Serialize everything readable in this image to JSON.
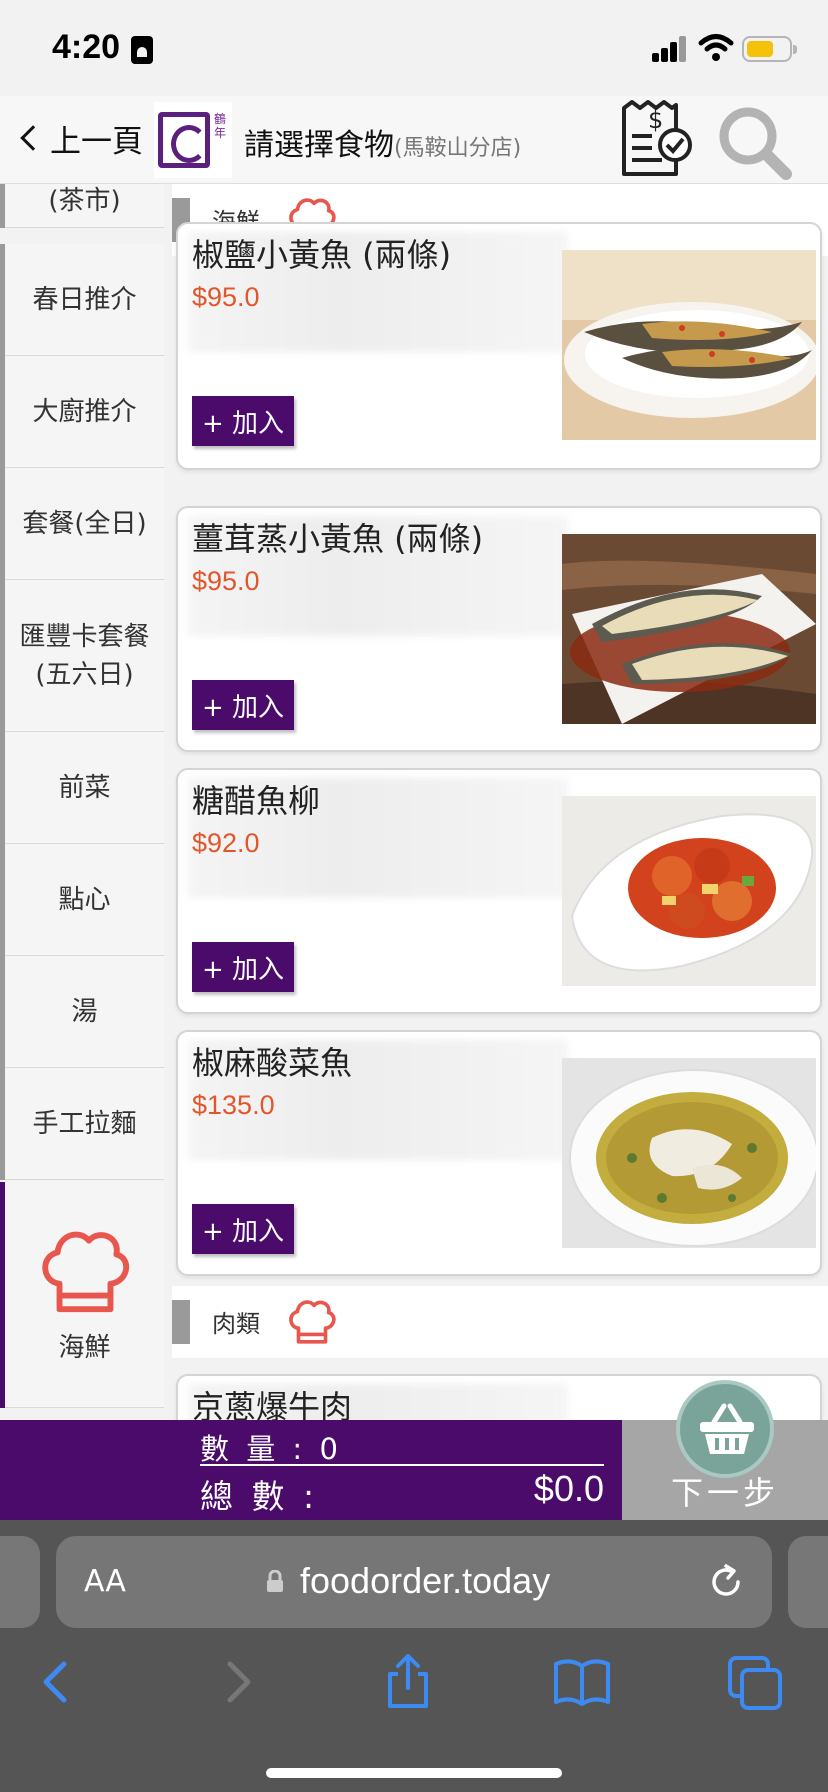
{
  "status": {
    "time": "4:20"
  },
  "header": {
    "back_label": "上一頁",
    "logo_text": "鶴年",
    "title": "請選擇食物",
    "branch": "(馬鞍山分店)"
  },
  "sidebar": {
    "items": [
      {
        "label": "(茶市)"
      },
      {
        "label": "春日推介"
      },
      {
        "label": "大廚推介"
      },
      {
        "label": "套餐(全日)"
      },
      {
        "label": "匯豐卡套餐(五六日)"
      },
      {
        "label": "前菜"
      },
      {
        "label": "點心"
      },
      {
        "label": "湯"
      },
      {
        "label": "手工拉麵"
      },
      {
        "label": "海鮮",
        "icon": "chef-hat-icon",
        "active": true
      }
    ]
  },
  "menu": {
    "sections": [
      {
        "label": "海鮮",
        "icon": "chef-hat-icon"
      },
      {
        "label": "肉類",
        "icon": "chef-hat-icon"
      }
    ],
    "add_label": "+ 加入",
    "items": [
      {
        "name": "椒鹽小黃魚 (兩條)",
        "price": "$95.0",
        "photo": "fried-fish-photo"
      },
      {
        "name": "薑茸蒸小黃魚 (兩條)",
        "price": "$95.0",
        "photo": "steamed-fish-photo"
      },
      {
        "name": "糖醋魚柳",
        "price": "$92.0",
        "photo": "sweet-sour-fish-photo"
      },
      {
        "name": "椒麻酸菜魚",
        "price": "$135.0",
        "photo": "pickled-cabbage-fish-photo"
      },
      {
        "name": "京蔥爆牛肉",
        "price": "",
        "photo": ""
      }
    ]
  },
  "order": {
    "qty_label": "數 量 : ",
    "qty_value": "0",
    "total_label": "總 數 :",
    "total_value": "$0.0",
    "next_label": "下一步"
  },
  "browser": {
    "aa_label": "AA",
    "url": "foodorder.today"
  },
  "colors": {
    "brand_purple": "#4b0b6b",
    "price_orange": "#e2562c",
    "chef_hat_red": "#e8574e"
  }
}
